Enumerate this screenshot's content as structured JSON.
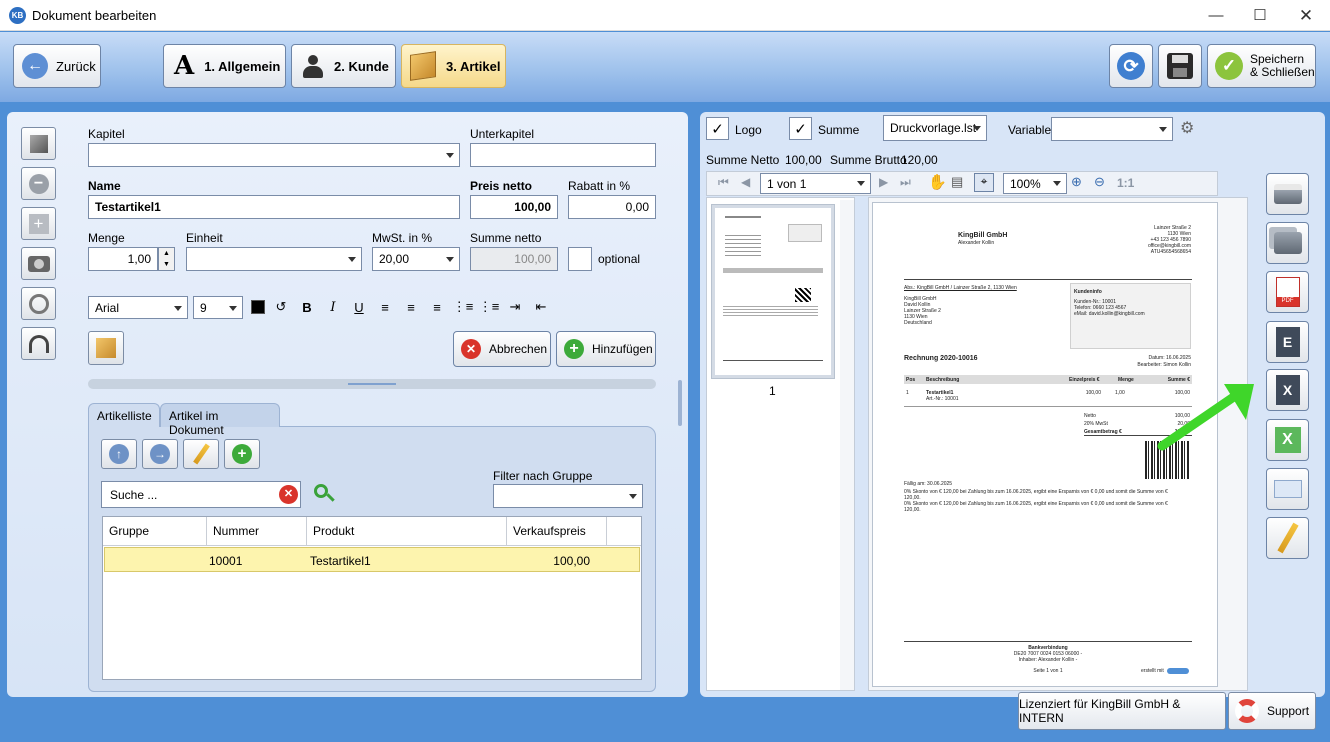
{
  "window": {
    "title": "Dokument bearbeiten",
    "logo": "KB"
  },
  "toolbar": {
    "back": "Zurück",
    "tabs": [
      {
        "label": "1. Allgemein"
      },
      {
        "label": "2. Kunde"
      },
      {
        "label": "3. Artikel"
      }
    ],
    "save_close": "Speichern\n& Schließen"
  },
  "form": {
    "kapitel_label": "Kapitel",
    "unterkapitel_label": "Unterkapitel",
    "name_label": "Name",
    "name_value": "Testartikel1",
    "preis_label": "Preis netto",
    "preis_value": "100,00",
    "rabatt_label": "Rabatt in %",
    "rabatt_value": "0,00",
    "menge_label": "Menge",
    "menge_value": "1,00",
    "einheit_label": "Einheit",
    "mwst_label": "MwSt. in %",
    "mwst_value": "20,00",
    "summe_label": "Summe netto",
    "summe_value": "100,00",
    "optional_label": "optional",
    "font_value": "Arial",
    "size_value": "9",
    "cancel": "Abbrechen",
    "add": "Hinzufügen"
  },
  "list": {
    "tabs": [
      "Artikelliste",
      "Artikel im Dokument"
    ],
    "search_placeholder": "Suche ...",
    "filter_label": "Filter nach Gruppe",
    "columns": [
      "Gruppe",
      "Nummer",
      "Produkt",
      "Verkaufspreis"
    ],
    "rows": [
      {
        "gruppe": "",
        "nummer": "10001",
        "produkt": "Testartikel1",
        "preis": "100,00"
      }
    ]
  },
  "preview": {
    "logo_label": "Logo",
    "summe_label": "Summe",
    "template_value": "Druckvorlage.lst",
    "variable_label": "Variable",
    "summe_netto_label": "Summe Netto",
    "summe_netto_value": "100,00",
    "summe_brutto_label": "Summe Brutto",
    "summe_brutto_value": "120,00",
    "page_value": "1 von 1",
    "zoom_value": "100%",
    "one_to_one": "1:1",
    "thumb_page": "1"
  },
  "invoice": {
    "company": "KingBill GmbH",
    "person": "Alexander Kollin",
    "addr_right": [
      "Lainzer Straße 2",
      "1130 Wien",
      "+43 123 456 7890",
      "office@kingbill.com",
      "",
      "ATU45654568654"
    ],
    "sender_line": "Abs.: KingBill GmbH / Lainzer Straße 2, 1130 Wien",
    "recipient": [
      "KingBill GmbH",
      "David Kollin",
      "Lainzer Straße 2",
      "1130 Wien",
      "Deutschland"
    ],
    "kundeninfo_title": "Kundeninfo",
    "kundeninfo": [
      "Kunden-Nr.:   10001",
      "Telefon:       0660 123 4567",
      "eMail:          david.kollin@kingbill.com"
    ],
    "doc_title": "Rechnung 2020-10016",
    "date_line": "Datum: 16.06.2025",
    "editor_line": "Bearbeiter: Simon Kollin",
    "table_head": [
      "Pos",
      "Beschreibung",
      "Einzelpreis €",
      "Menge",
      "Summe €"
    ],
    "row": [
      "1",
      "Testartikel1",
      "100,00",
      "1,00",
      "100,00"
    ],
    "row_sub": "Art.-Nr.: 10001",
    "totals": [
      [
        "Netto",
        "100,00"
      ],
      [
        "20% MwSt",
        "20,00"
      ],
      [
        "Gesamtbetrag €",
        "120,00"
      ]
    ],
    "due": "Fällig am: 30.06.2025",
    "skonto1": "0% Skonto von € 120,00 bei Zahlung bis zum 16.06.2025, ergibt eine Ersparnis von € 0,00 und somit die Summe von €",
    "skonto1b": "120,00.",
    "skonto2": "0% Skonto von € 120,00 bei Zahlung bis zum 16.06.2025, ergibt eine Ersparnis von € 0,00 und somit die Summe von €",
    "skonto2b": "120,00.",
    "bank_title": "Bankverbindung",
    "bank_iban": "DE20 7007 0024 0153 06000 -",
    "bank_owner": "Inhaber: Alexander Kollin -",
    "page_foot": "Seite 1 von 1",
    "created_with": "erstellt mit"
  },
  "footer": {
    "license": "Lizenziert für KingBill GmbH & INTERN",
    "support": "Support"
  },
  "colors": {
    "accent": "#4f8fd6",
    "highlight_row": "#fdf4ae",
    "arrow": "#3fd62a"
  }
}
